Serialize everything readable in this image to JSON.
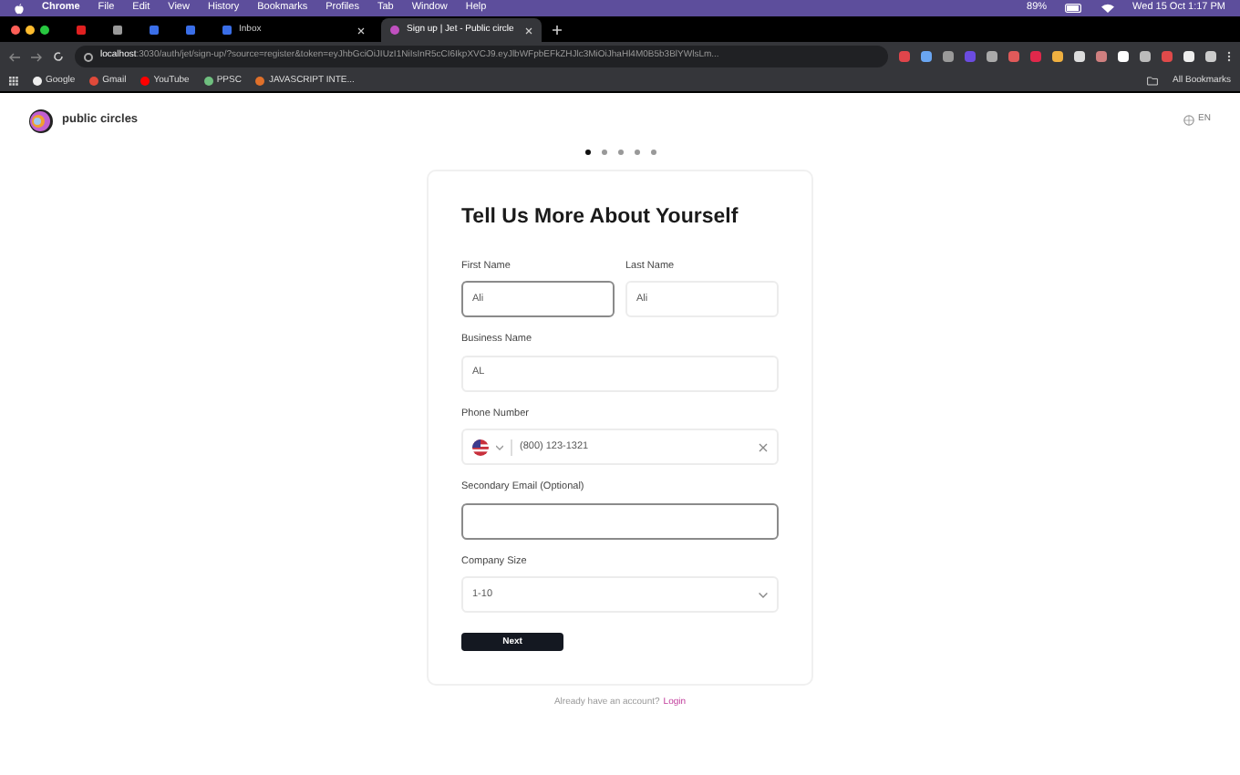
{
  "menu_bar": {
    "app": "Chrome",
    "items": [
      "File",
      "Edit",
      "View",
      "History",
      "Bookmarks",
      "Profiles",
      "Tab",
      "Window",
      "Help"
    ],
    "battery": "89%",
    "clock": "Wed 15 Oct  1:17 PM"
  },
  "tabs": [
    {
      "selected": false
    },
    {
      "selected": false
    },
    {
      "selected": false
    },
    {
      "selected": false
    },
    {
      "title": "Inbox",
      "selected": false
    },
    {
      "title": "Sign up | Jet - Public circle",
      "selected": true
    }
  ],
  "address_bar": {
    "host": "localhost",
    "path": ":3030/auth/jet/sign-up/?source=register&token=eyJhbGciOiJIUzI1NiIsInR5cCI6IkpXVCJ9.eyJlbWFpbEFkZHJlc3MiOiJhaHl4M0B5b3BlYWlsLm..."
  },
  "bookmarks": [
    "Google",
    "Gmail",
    "YouTube",
    "PPSC",
    "JAVASCRIPT INTE..."
  ],
  "all_bookmarks": "All Bookmarks",
  "header": {
    "brand": "public circles",
    "language": "EN"
  },
  "steps": [
    {
      "selected": true
    },
    {
      "selected": false
    },
    {
      "selected": false
    },
    {
      "selected": false
    },
    {
      "selected": false
    }
  ],
  "form": {
    "title": "Tell Us More About Yourself",
    "rows": [
      [
        {
          "kind": "text",
          "label": "First Name",
          "value": "Ali",
          "focused": true
        },
        {
          "kind": "text",
          "label": "Last Name",
          "value": "Ali",
          "focused": false
        }
      ],
      [
        {
          "kind": "text",
          "label": "Business Name",
          "value": "AL",
          "focused": false
        }
      ],
      [
        {
          "kind": "phone",
          "label": "Phone Number",
          "value": "(800) 123-1321",
          "focused": false
        }
      ],
      [
        {
          "kind": "text",
          "label": "Secondary Email (Optional)",
          "focused": true
        }
      ],
      [
        {
          "kind": "select",
          "label": "Company Size",
          "value": "1-10",
          "focused": false
        }
      ]
    ],
    "submit": "Next"
  },
  "footer": {
    "text": "Already have an account?",
    "link": "Login"
  }
}
